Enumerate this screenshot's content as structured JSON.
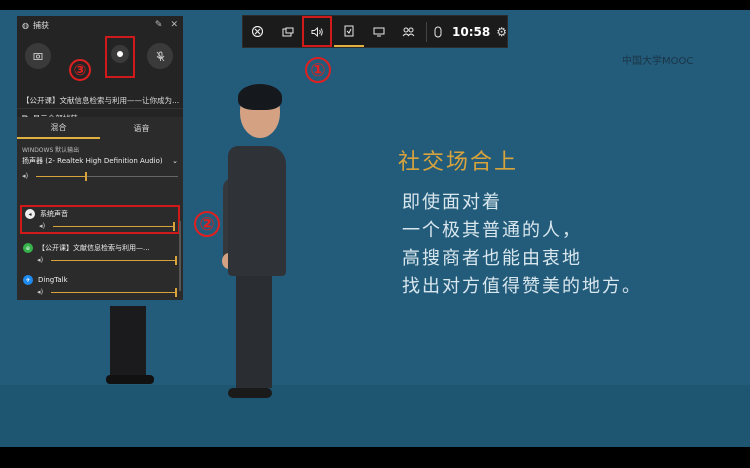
{
  "gamebar": {
    "buttons": [
      "xbox-icon",
      "capture-widget-icon",
      "audio-icon",
      "performance-icon",
      "resources-icon",
      "social-icon",
      "mouse-icon"
    ],
    "time": "10:58",
    "settings_icon": "gear-icon"
  },
  "capture_panel": {
    "title": "捕获",
    "caption": "【公开课】文献信息检索与利用——让你成为...",
    "show_all": "显示全部捕获"
  },
  "audio_panel": {
    "tabs": [
      "混合",
      "语音"
    ],
    "output_label": "WINDOWS 默认输出",
    "device": "扬声器 (2- Realtek High Definition Audio)",
    "master_level": 0.35,
    "apps": [
      {
        "name": "系统声音",
        "level": 1.0,
        "icon_color": "#ffffff"
      },
      {
        "name": "【公开课】文献信息检索与利用—...",
        "level": 1.0,
        "icon_color": "#36b34a"
      },
      {
        "name": "DingTalk",
        "level": 1.0,
        "icon_color": "#1d8bf0"
      }
    ]
  },
  "video": {
    "logo": "中国大学MOOC",
    "title": "社交场合上",
    "lines": [
      "即使面对着",
      "一个极其普通的人，",
      "高搜商者也能由衷地",
      "找出对方值得赞美的地方。"
    ]
  },
  "annotations": [
    "①",
    "②",
    "③"
  ],
  "colors": {
    "highlight": "#d01a1a",
    "accent": "#d9a33c",
    "background": "#235c7a"
  }
}
